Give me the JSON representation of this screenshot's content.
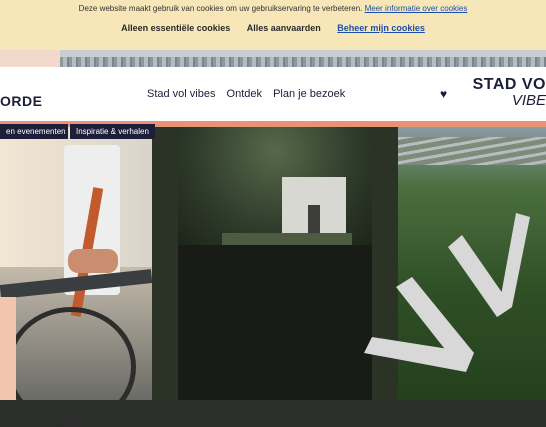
{
  "cookie_banner": {
    "message": "Deze website maakt gebruik van cookies om uw gebruikservaring te verbeteren.",
    "more_info_link": "Meer informatie over cookies",
    "essential_button": "Alleen essentiële cookies",
    "accept_all_button": "Alles aanvaarden",
    "manage_link": "Beheer mijn cookies"
  },
  "header": {
    "logo_text": "ORDE",
    "nav": [
      "Stad vol vibes",
      "Ontdek",
      "Plan je bezoek"
    ],
    "favorites_icon": "heart-icon",
    "brand_line1": "STAD VO",
    "brand_line2": "VIBE"
  },
  "subnav": {
    "tabs": [
      "en evenementen",
      "Inspiratie & verhalen"
    ]
  },
  "colors": {
    "navy": "#1c1e3a",
    "cookie_bg": "#f6e6b8",
    "accent_band": "#e89276",
    "link": "#1c4fa8"
  }
}
